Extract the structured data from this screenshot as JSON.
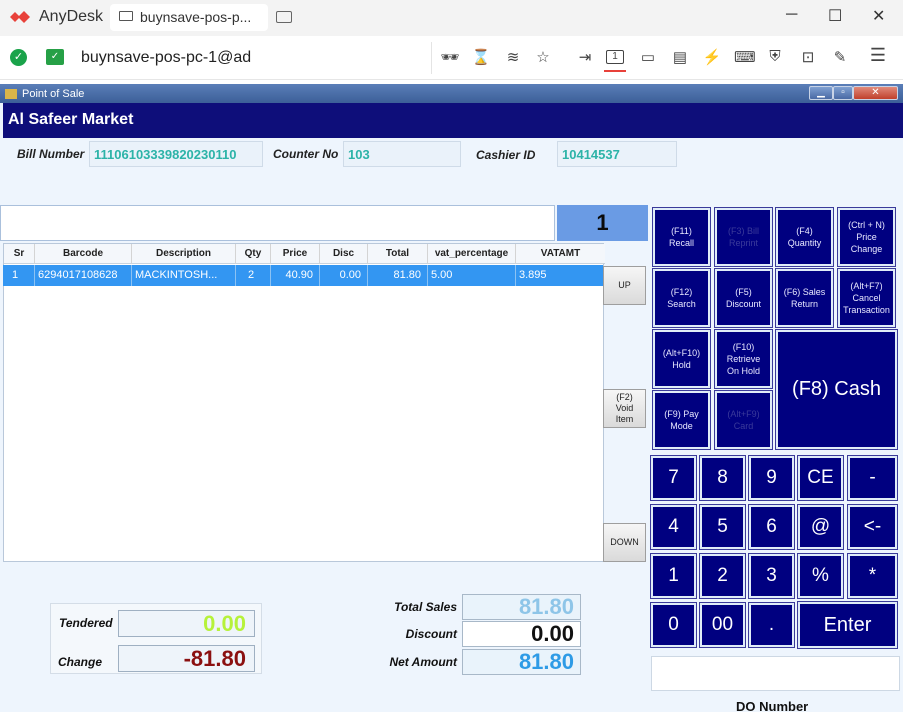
{
  "anydesk": {
    "app_name": "AnyDesk",
    "tab_label": "buynsave-pos-p...",
    "address": "buynsave-pos-pc-1@ad",
    "window_buttons": [
      "─",
      "☐",
      "✕"
    ],
    "toolbar_icons": [
      "incognito-icon",
      "hourglass-icon",
      "database-icon",
      "star-icon",
      "enter-icon",
      "display-1-icon",
      "monitor-icon",
      "chat-icon",
      "lightning-icon",
      "keyboard-icon",
      "shield-icon",
      "record-icon",
      "pen-icon",
      "menu-icon"
    ]
  },
  "pos": {
    "window_title": "Point of Sale",
    "store_name": "Al Safeer Market",
    "bill_number_label": "Bill Number",
    "bill_number": "11106103339820230110",
    "counter_no_label": "Counter No",
    "counter_no": "103",
    "cashier_id_label": "Cashier ID",
    "cashier_id": "10414537",
    "quantity_display": "1",
    "grid": {
      "columns": [
        "Sr",
        "Barcode",
        "Description",
        "Qty",
        "Price",
        "Disc",
        "Total",
        "vat_percentage",
        "VATAMT"
      ],
      "rows": [
        {
          "sr": "1",
          "barcode": "6294017108628",
          "description": "MACKINTOSH...",
          "qty": "2",
          "price": "40.90",
          "disc": "0.00",
          "total": "81.80",
          "vat_percentage": "5.00",
          "vatamt": "3.895"
        }
      ]
    },
    "side_buttons": {
      "up": "UP",
      "void": "(F2)\nVoid\nItem",
      "down": "DOWN"
    },
    "function_keys": {
      "recall": "(F11)\nRecall",
      "reprint": "(F3) Bill\nReprint",
      "quantity": "(F4)\nQuantity",
      "price_change": "(Ctrl + N)\nPrice\nChange",
      "search": "(F12)\nSearch",
      "discount": "(F5)\nDiscount",
      "sales_return": "(F6) Sales\nReturn",
      "cancel_transaction": "(Alt+F7)\nCancel\nTransaction",
      "hold": "(Alt+F10)\nHold",
      "retrieve": "(F10)\nRetrieve\nOn Hold",
      "pay_mode": "(F9) Pay\nMode",
      "card": "(Alt+F9)\nCard",
      "cash": "(F8) Cash"
    },
    "numpad": [
      "7",
      "8",
      "9",
      "CE",
      "-",
      "4",
      "5",
      "6",
      "@",
      "<-",
      "1",
      "2",
      "3",
      "%",
      "*",
      "0",
      "00",
      "."
    ],
    "enter_label": "Enter",
    "tendered_label": "Tendered",
    "tendered_value": "0.00",
    "change_label": "Change",
    "change_value": "-81.80",
    "total_sales_label": "Total Sales",
    "total_sales_value": "81.80",
    "discount_label": "Discount",
    "discount_value": "0.00",
    "net_amount_label": "Net Amount",
    "net_amount_value": "81.80",
    "do_number_label": "DO Number"
  },
  "colors": {
    "header_navy": "#0e0e7a",
    "key_navy": "#000080",
    "row_highlight": "#3396f2",
    "tendered_green": "#b6f23a",
    "change_red": "#8b1010",
    "sales_blue": "#8ec5e8",
    "net_blue": "#2e9be6"
  }
}
